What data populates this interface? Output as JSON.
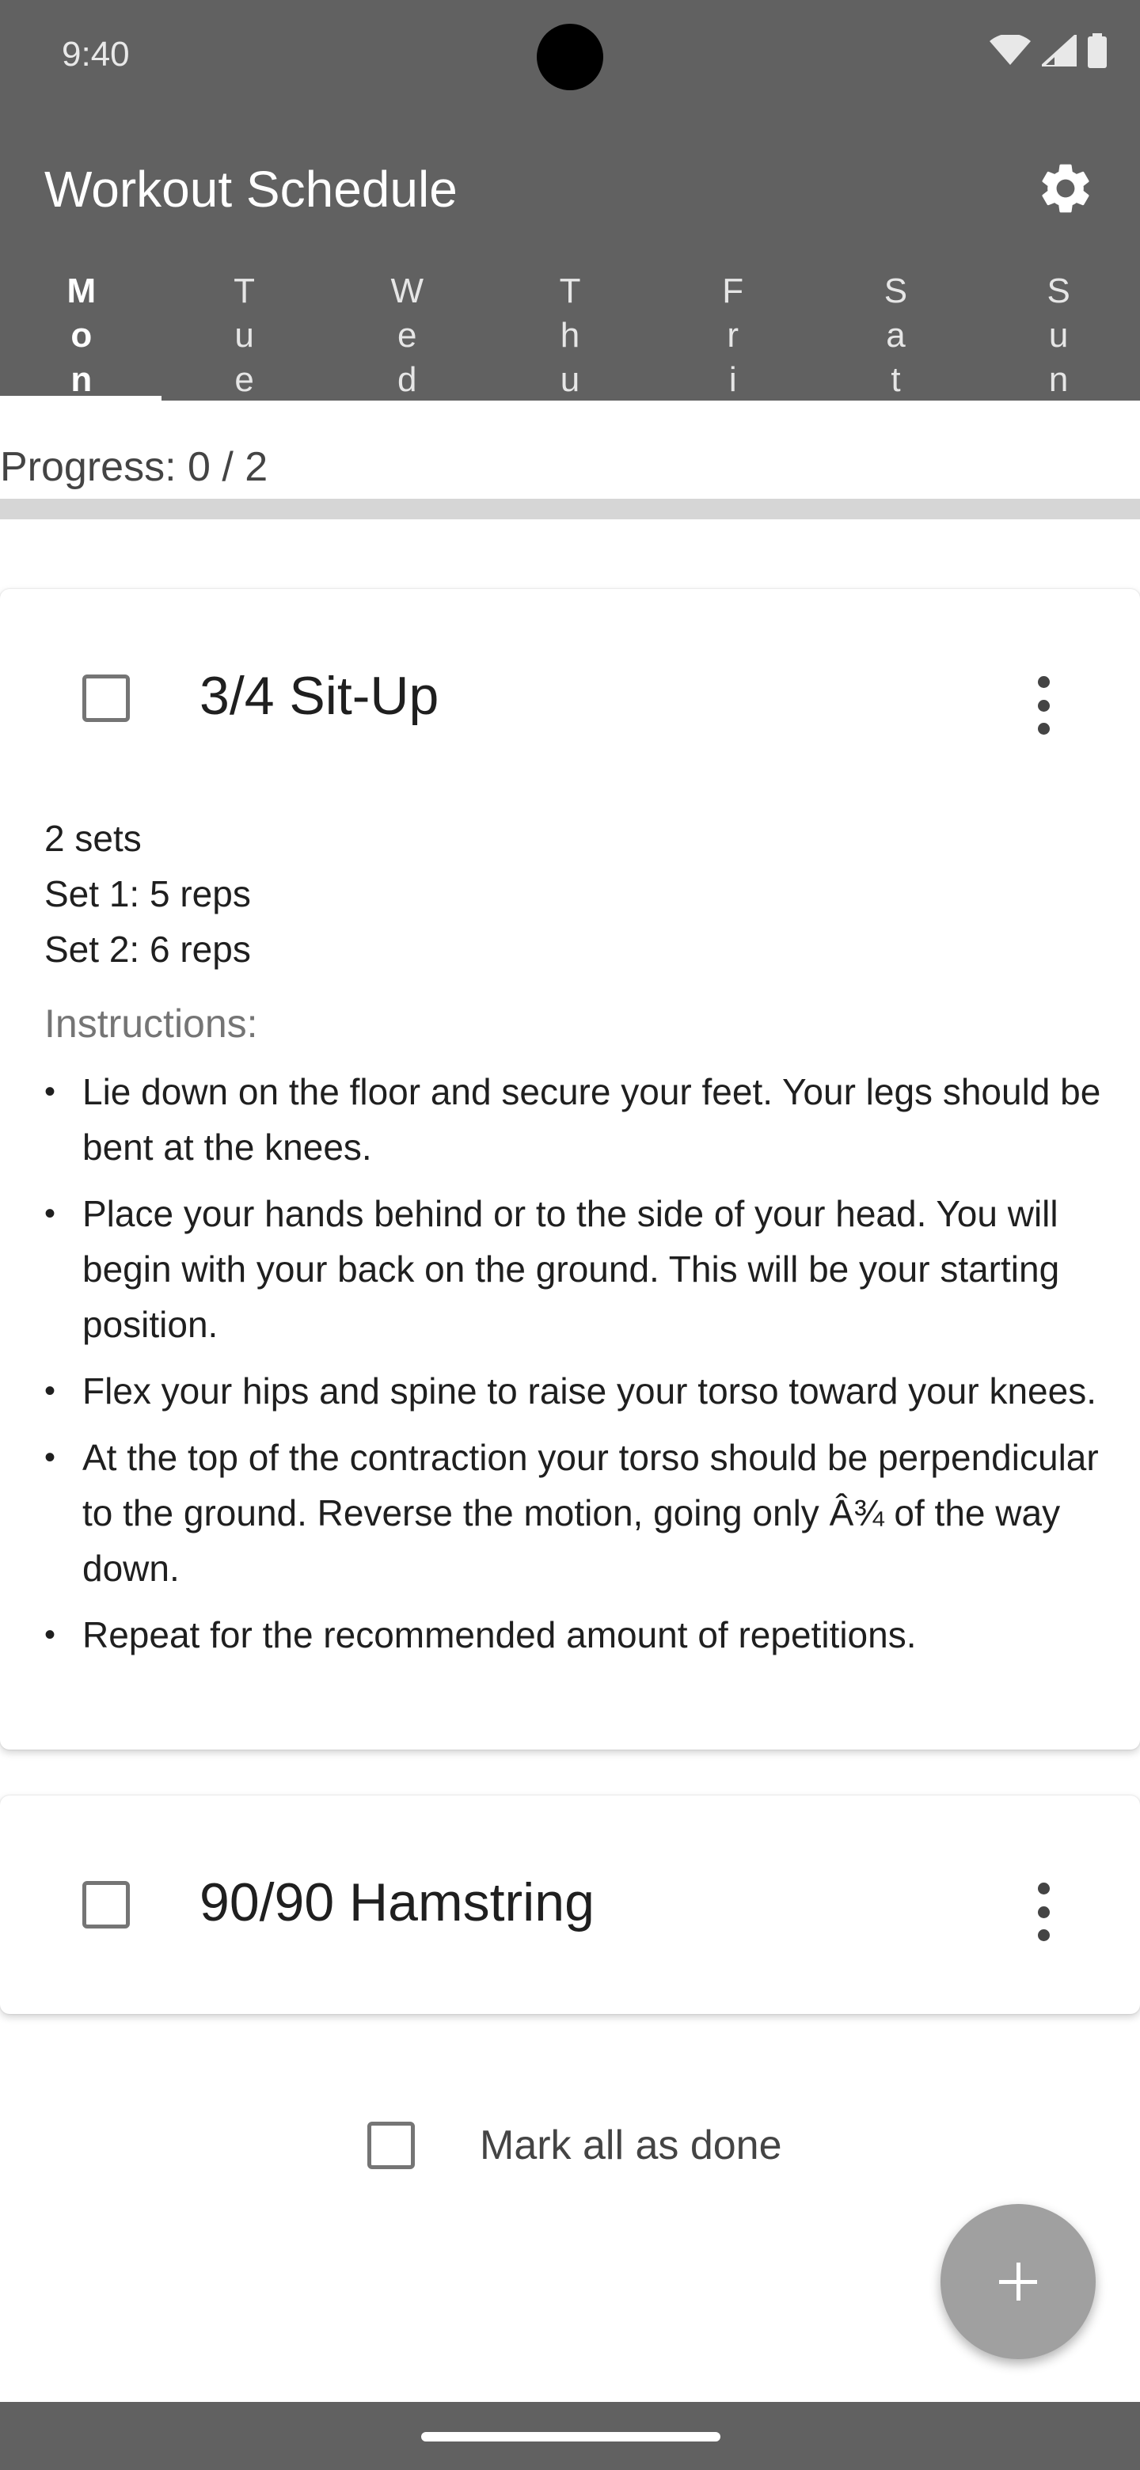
{
  "status": {
    "time": "9:40"
  },
  "header": {
    "title": "Workout Schedule",
    "tabs": [
      {
        "chars": [
          "M",
          "o",
          "n"
        ],
        "active": true
      },
      {
        "chars": [
          "T",
          "u",
          "e"
        ],
        "active": false
      },
      {
        "chars": [
          "W",
          "e",
          "d"
        ],
        "active": false
      },
      {
        "chars": [
          "T",
          "h",
          "u"
        ],
        "active": false
      },
      {
        "chars": [
          "F",
          "r",
          "i"
        ],
        "active": false
      },
      {
        "chars": [
          "S",
          "a",
          "t"
        ],
        "active": false
      },
      {
        "chars": [
          "S",
          "u",
          "n"
        ],
        "active": false
      }
    ]
  },
  "progress": {
    "text": "Progress: 0 / 2",
    "fraction": 0
  },
  "exercises": [
    {
      "title": "3/4 Sit-Up",
      "sets_summary": "2 sets",
      "sets": [
        "Set 1: 5 reps",
        "Set 2: 6 reps"
      ],
      "instructions_label": "Instructions:",
      "instructions": [
        "Lie down on the floor and secure your feet. Your legs should be bent at the knees.",
        "Place your hands behind or to the side of your head. You will begin with your back on the ground. This will be your starting position.",
        "Flex your hips and spine to raise your torso toward your knees.",
        "At the top of the contraction your torso should be perpendicular to the ground. Reverse the motion, going only Â¾ of the way down.",
        "Repeat for the recommended amount of repetitions."
      ]
    },
    {
      "title": "90/90 Hamstring"
    }
  ],
  "mark_all": {
    "label": "Mark all as done"
  },
  "icons": {
    "settings": "gear-icon",
    "overflow": "more-vert-icon",
    "add": "plus-icon",
    "wifi": "wifi-icon",
    "signal": "signal-icon",
    "battery": "battery-icon"
  },
  "colors": {
    "bar": "#616161",
    "fab": "#a0a0a0",
    "progress_track": "#d6d6d6"
  }
}
